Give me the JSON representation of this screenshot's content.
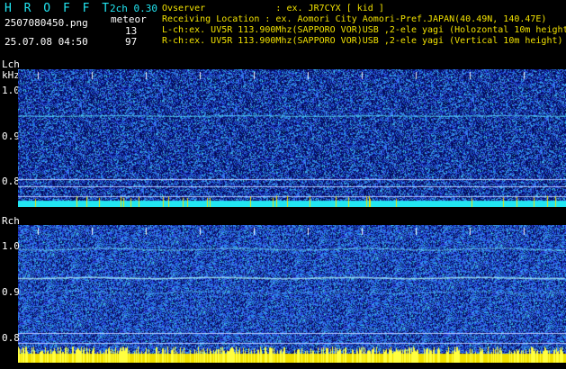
{
  "header": {
    "app_title": "H R O F F T",
    "version": "2ch 0.30",
    "filename": "2507080450.png",
    "datetime": "25.07.08 04:50",
    "meteor_label": "meteor",
    "meteor_count_l": "13",
    "meteor_count_r": "97",
    "observer_line": "Ovserver             : ex. JR7CYX [ kid ]",
    "location_line": "Receiving Location : ex. Aomori City Aomori-Pref.JAPAN(40.49N, 140.47E)",
    "lch_line": "L-ch:ex. UV5R 113.900Mhz(SAPPORO VOR)USB ,2-ele yagi (Holozontal 10m height",
    "rch_line": "R-ch:ex. UV5R 113.900Mhz(SAPPORO VOR)USB ,2-ele yagi (Vertical 10m height)"
  },
  "left_channel": {
    "label": "Lch",
    "unit": "kHz",
    "y_ticks": [
      "1.0",
      "0.9",
      "0.8"
    ],
    "times": [
      "0451",
      "0452",
      "0453",
      "0454",
      "0455",
      "0456",
      "0457",
      "0458",
      "0459",
      "0500"
    ],
    "right_edge_label": "2"
  },
  "right_channel": {
    "label": "Rch",
    "y_ticks": [
      "1.0",
      "0.9",
      "0.8"
    ]
  },
  "colors": {
    "noise_dark": "#0a1a8c",
    "noise_mid": "#1f4de0",
    "trace_cyan": "#22e6f2",
    "meteor_yellow": "#f0e000"
  }
}
